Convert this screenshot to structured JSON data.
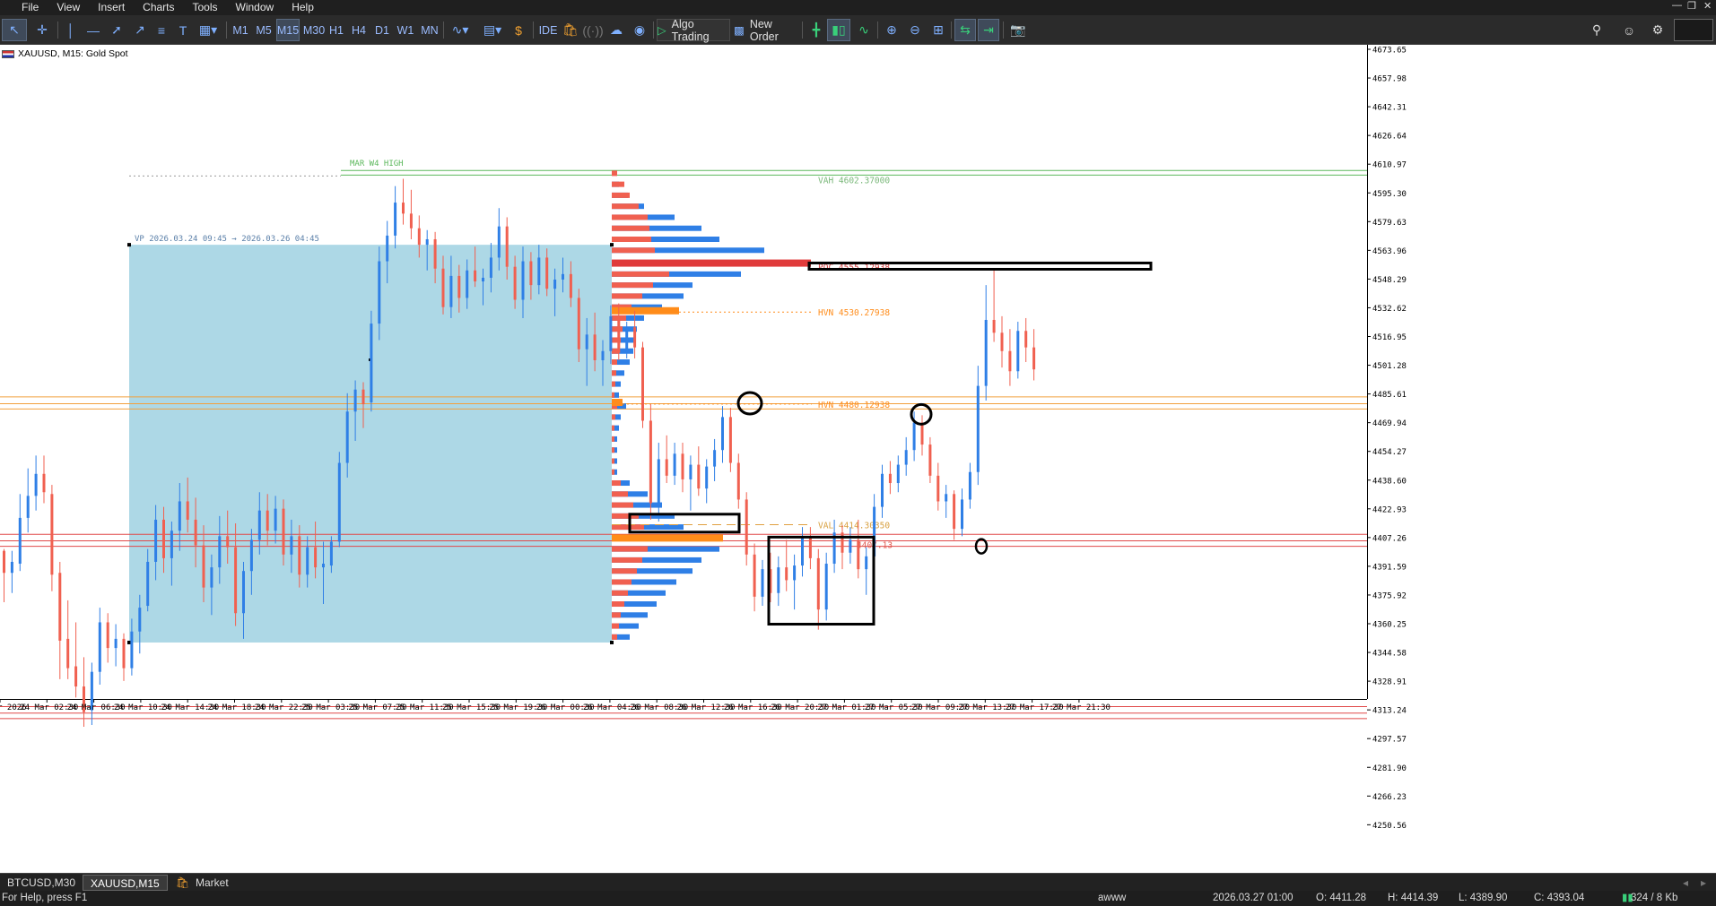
{
  "menu": {
    "items": [
      "File",
      "View",
      "Insert",
      "Charts",
      "Tools",
      "Window",
      "Help"
    ]
  },
  "toolbar": {
    "timeframes": [
      "M1",
      "M5",
      "M15",
      "M30",
      "H1",
      "H4",
      "D1",
      "W1",
      "MN"
    ],
    "selected_timeframe": "M15",
    "ide_label": "IDE",
    "algo_trading_label": "Algo Trading",
    "new_order_label": "New Order",
    "tools_left_icons": [
      "cursor-icon",
      "crosshair-icon",
      "vertical-line-icon",
      "horizontal-line-icon",
      "trend-line-icon",
      "channel-icon",
      "fibonacci-icon",
      "text-icon",
      "shapes-icon"
    ],
    "tools_right_icons": [
      "indicators-icon",
      "templates-icon",
      "dollar-icon",
      "market-icon",
      "signals-icon",
      "vps-icon",
      "community-icon"
    ]
  },
  "chart": {
    "symbol_label": "XAUUSD, M15:  Gold Spot",
    "price_axis": [
      "4673.65",
      "4657.98",
      "4642.31",
      "4626.64",
      "4610.97",
      "4595.30",
      "4579.63",
      "4563.96",
      "4548.29",
      "4532.62",
      "4516.95",
      "4501.28",
      "4485.61",
      "4469.94",
      "4454.27",
      "4438.60",
      "4422.93",
      "4407.26",
      "4391.59",
      "4375.92",
      "4360.25",
      "4344.58",
      "4328.91",
      "4313.24",
      "4297.57",
      "4281.90",
      "4266.23",
      "4250.56"
    ],
    "time_axis": [
      "23 Mar 2026",
      "24 Mar 02:30",
      "24 Mar 06:30",
      "24 Mar 10:30",
      "24 Mar 14:30",
      "24 Mar 18:30",
      "24 Mar 22:30",
      "25 Mar 03:30",
      "25 Mar 07:30",
      "25 Mar 11:30",
      "25 Mar 15:30",
      "25 Mar 19:30",
      "26 Mar 00:30",
      "26 Mar 04:30",
      "26 Mar 08:30",
      "26 Mar 12:30",
      "26 Mar 16:30",
      "26 Mar 20:30",
      "27 Mar 01:30",
      "27 Mar 05:30",
      "27 Mar 09:30",
      "27 Mar 13:30",
      "27 Mar 17:30",
      "27 Mar 21:30"
    ],
    "annotations": {
      "vp_label": "VP  2026.03.24 09:45 → 2026.03.26 04:45",
      "mar_w4_high": "MAR W4 HIGH",
      "vah_label": "VAH 4602.37000",
      "poc_label": "POC 4555.12938",
      "hvn1_label": "HVN 4530.27938",
      "hvn2_label": "HVN 4480.12938",
      "val_label": "VAL 4414.30350",
      "lvn_label": "4407.13"
    },
    "colors": {
      "bull": "#2f7fe6",
      "bear": "#f06050",
      "vp_box": "#add8e6",
      "hvn": "#ff8c1a",
      "poc": "#e03b3b",
      "level_green": "#5cb85c"
    },
    "levels": {
      "green": [
        4607.5,
        4605.0
      ],
      "orange": [
        4484.0,
        4480.3,
        4477.4
      ],
      "red_mid": [
        4409.0,
        4405.5,
        4402.5
      ],
      "red_low": [
        4315.0,
        4311.5,
        4308.5
      ]
    },
    "candles": [
      [
        4400,
        4401,
        4372,
        4388
      ],
      [
        4388,
        4400,
        4377,
        4394
      ],
      [
        4393,
        4431,
        4389,
        4418
      ],
      [
        4418,
        4445,
        4410,
        4430
      ],
      [
        4430,
        4452,
        4422,
        4442
      ],
      [
        4442,
        4452,
        4426,
        4432
      ],
      [
        4431,
        4436,
        4378,
        4387
      ],
      [
        4388,
        4394,
        4330,
        4351
      ],
      [
        4352,
        4373,
        4330,
        4336
      ],
      [
        4337,
        4361,
        4320,
        4326
      ],
      [
        4326,
        4342,
        4304,
        4312
      ],
      [
        4313,
        4339,
        4305,
        4334
      ],
      [
        4334,
        4369,
        4327,
        4361
      ],
      [
        4361,
        4366,
        4339,
        4347
      ],
      [
        4347,
        4360,
        4337,
        4352
      ],
      [
        4352,
        4355,
        4329,
        4336
      ],
      [
        4336,
        4363,
        4332,
        4356
      ],
      [
        4356,
        4376,
        4344,
        4369
      ],
      [
        4370,
        4401,
        4367,
        4394
      ],
      [
        4394,
        4425,
        4384,
        4417
      ],
      [
        4417,
        4424,
        4388,
        4396
      ],
      [
        4396,
        4416,
        4381,
        4411
      ],
      [
        4411,
        4437,
        4400,
        4427
      ],
      [
        4427,
        4440,
        4410,
        4417
      ],
      [
        4417,
        4429,
        4391,
        4403
      ],
      [
        4403,
        4414,
        4372,
        4380
      ],
      [
        4380,
        4398,
        4365,
        4391
      ],
      [
        4391,
        4419,
        4382,
        4408
      ],
      [
        4408,
        4422,
        4393,
        4402
      ],
      [
        4402,
        4415,
        4359,
        4366
      ],
      [
        4366,
        4394,
        4352,
        4389
      ],
      [
        4389,
        4412,
        4376,
        4406
      ],
      [
        4406,
        4432,
        4398,
        4422
      ],
      [
        4422,
        4431,
        4403,
        4411
      ],
      [
        4411,
        4430,
        4404,
        4423
      ],
      [
        4423,
        4428,
        4392,
        4398
      ],
      [
        4398,
        4417,
        4388,
        4408
      ],
      [
        4408,
        4414,
        4380,
        4387
      ],
      [
        4387,
        4408,
        4380,
        4402
      ],
      [
        4402,
        4416,
        4385,
        4391
      ],
      [
        4391,
        4405,
        4371,
        4393
      ],
      [
        4392,
        4408,
        4388,
        4405
      ],
      [
        4405,
        4454,
        4402,
        4448
      ],
      [
        4448,
        4486,
        4440,
        4476
      ],
      [
        4476,
        4493,
        4460,
        4488
      ],
      [
        4488,
        4492,
        4467,
        4480
      ],
      [
        4481,
        4531,
        4476,
        4524
      ],
      [
        4524,
        4566,
        4515,
        4558
      ],
      [
        4558,
        4580,
        4546,
        4572
      ],
      [
        4572,
        4599,
        4565,
        4590
      ],
      [
        4590,
        4603,
        4578,
        4584
      ],
      [
        4584,
        4597,
        4570,
        4576
      ],
      [
        4576,
        4583,
        4560,
        4567
      ],
      [
        4567,
        4575,
        4553,
        4570
      ],
      [
        4570,
        4574,
        4546,
        4554
      ],
      [
        4554,
        4561,
        4529,
        4533
      ],
      [
        4533,
        4561,
        4527,
        4550
      ],
      [
        4550,
        4556,
        4530,
        4538
      ],
      [
        4538,
        4559,
        4532,
        4553
      ],
      [
        4553,
        4566,
        4544,
        4547
      ],
      [
        4547,
        4554,
        4534,
        4549
      ],
      [
        4549,
        4568,
        4541,
        4560
      ],
      [
        4560,
        4587,
        4553,
        4577
      ],
      [
        4577,
        4582,
        4548,
        4555
      ],
      [
        4555,
        4561,
        4532,
        4537
      ],
      [
        4537,
        4566,
        4527,
        4558
      ],
      [
        4558,
        4563,
        4537,
        4545
      ],
      [
        4545,
        4567,
        4540,
        4560
      ],
      [
        4560,
        4565,
        4539,
        4543
      ],
      [
        4543,
        4554,
        4528,
        4548
      ],
      [
        4548,
        4560,
        4541,
        4551
      ],
      [
        4551,
        4558,
        4533,
        4538
      ],
      [
        4538,
        4543,
        4503,
        4510
      ],
      [
        4510,
        4527,
        4490,
        4518
      ],
      [
        4518,
        4530,
        4498,
        4504
      ],
      [
        4504,
        4515,
        4490,
        4509
      ],
      [
        4509,
        4534,
        4502,
        4528
      ],
      [
        4528,
        4535,
        4504,
        4508
      ],
      [
        4508,
        4525,
        4505,
        4522
      ],
      [
        4522,
        4531,
        4505,
        4511
      ],
      [
        4511,
        4514,
        4467,
        4471
      ],
      [
        4471,
        4480,
        4417,
        4426
      ],
      [
        4426,
        4459,
        4416,
        4450
      ],
      [
        4450,
        4463,
        4437,
        4441
      ],
      [
        4441,
        4459,
        4436,
        4453
      ],
      [
        4453,
        4459,
        4432,
        4439
      ],
      [
        4439,
        4452,
        4422,
        4447
      ],
      [
        4447,
        4457,
        4430,
        4434
      ],
      [
        4434,
        4450,
        4426,
        4446
      ],
      [
        4446,
        4461,
        4438,
        4455
      ],
      [
        4455,
        4479,
        4448,
        4473
      ],
      [
        4473,
        4478,
        4443,
        4448
      ],
      [
        4448,
        4453,
        4423,
        4428
      ],
      [
        4428,
        4432,
        4392,
        4398
      ],
      [
        4398,
        4404,
        4367,
        4375
      ],
      [
        4375,
        4395,
        4370,
        4390
      ],
      [
        4390,
        4399,
        4372,
        4377
      ],
      [
        4377,
        4397,
        4370,
        4391
      ],
      [
        4391,
        4406,
        4378,
        4384
      ],
      [
        4384,
        4398,
        4368,
        4392
      ],
      [
        4392,
        4413,
        4386,
        4407
      ],
      [
        4407,
        4413,
        4390,
        4396
      ],
      [
        4396,
        4401,
        4357,
        4368
      ],
      [
        4368,
        4399,
        4362,
        4393
      ],
      [
        4393,
        4417,
        4388,
        4410
      ],
      [
        4410,
        4414,
        4390,
        4399
      ],
      [
        4399,
        4413,
        4393,
        4406
      ],
      [
        4406,
        4417,
        4385,
        4390
      ],
      [
        4390,
        4402,
        4376,
        4397
      ],
      [
        4397,
        4431,
        4392,
        4424
      ],
      [
        4424,
        4447,
        4418,
        4442
      ],
      [
        4442,
        4449,
        4431,
        4437
      ],
      [
        4437,
        4452,
        4432,
        4447
      ],
      [
        4447,
        4462,
        4441,
        4455
      ],
      [
        4455,
        4476,
        4449,
        4470
      ],
      [
        4470,
        4474,
        4452,
        4458
      ],
      [
        4458,
        4462,
        4437,
        4441
      ],
      [
        4441,
        4448,
        4422,
        4427
      ],
      [
        4427,
        4436,
        4418,
        4431
      ],
      [
        4431,
        4433,
        4406,
        4412
      ],
      [
        4412,
        4434,
        4408,
        4428
      ],
      [
        4428,
        4448,
        4423,
        4443
      ],
      [
        4443,
        4501,
        4436,
        4490
      ],
      [
        4490,
        4545,
        4482,
        4526
      ],
      [
        4526,
        4553,
        4514,
        4519
      ],
      [
        4519,
        4528,
        4500,
        4509
      ],
      [
        4509,
        4521,
        4490,
        4498
      ],
      [
        4498,
        4525,
        4494,
        4520
      ],
      [
        4520,
        4527,
        4503,
        4511
      ],
      [
        4511,
        4521,
        4493,
        4499
      ]
    ]
  },
  "tabs": {
    "items": [
      "BTCUSD,M30",
      "XAUUSD,M15",
      "Market"
    ],
    "active": "XAUUSD,M15"
  },
  "status": {
    "help": "For Help, press F1",
    "profile": "awww",
    "datetime": "2026.03.27 01:00",
    "open": "O: 4411.28",
    "high": "H: 4414.39",
    "low": "L: 4389.90",
    "close": "C: 4393.04",
    "traffic": "324 / 8 Kb"
  }
}
